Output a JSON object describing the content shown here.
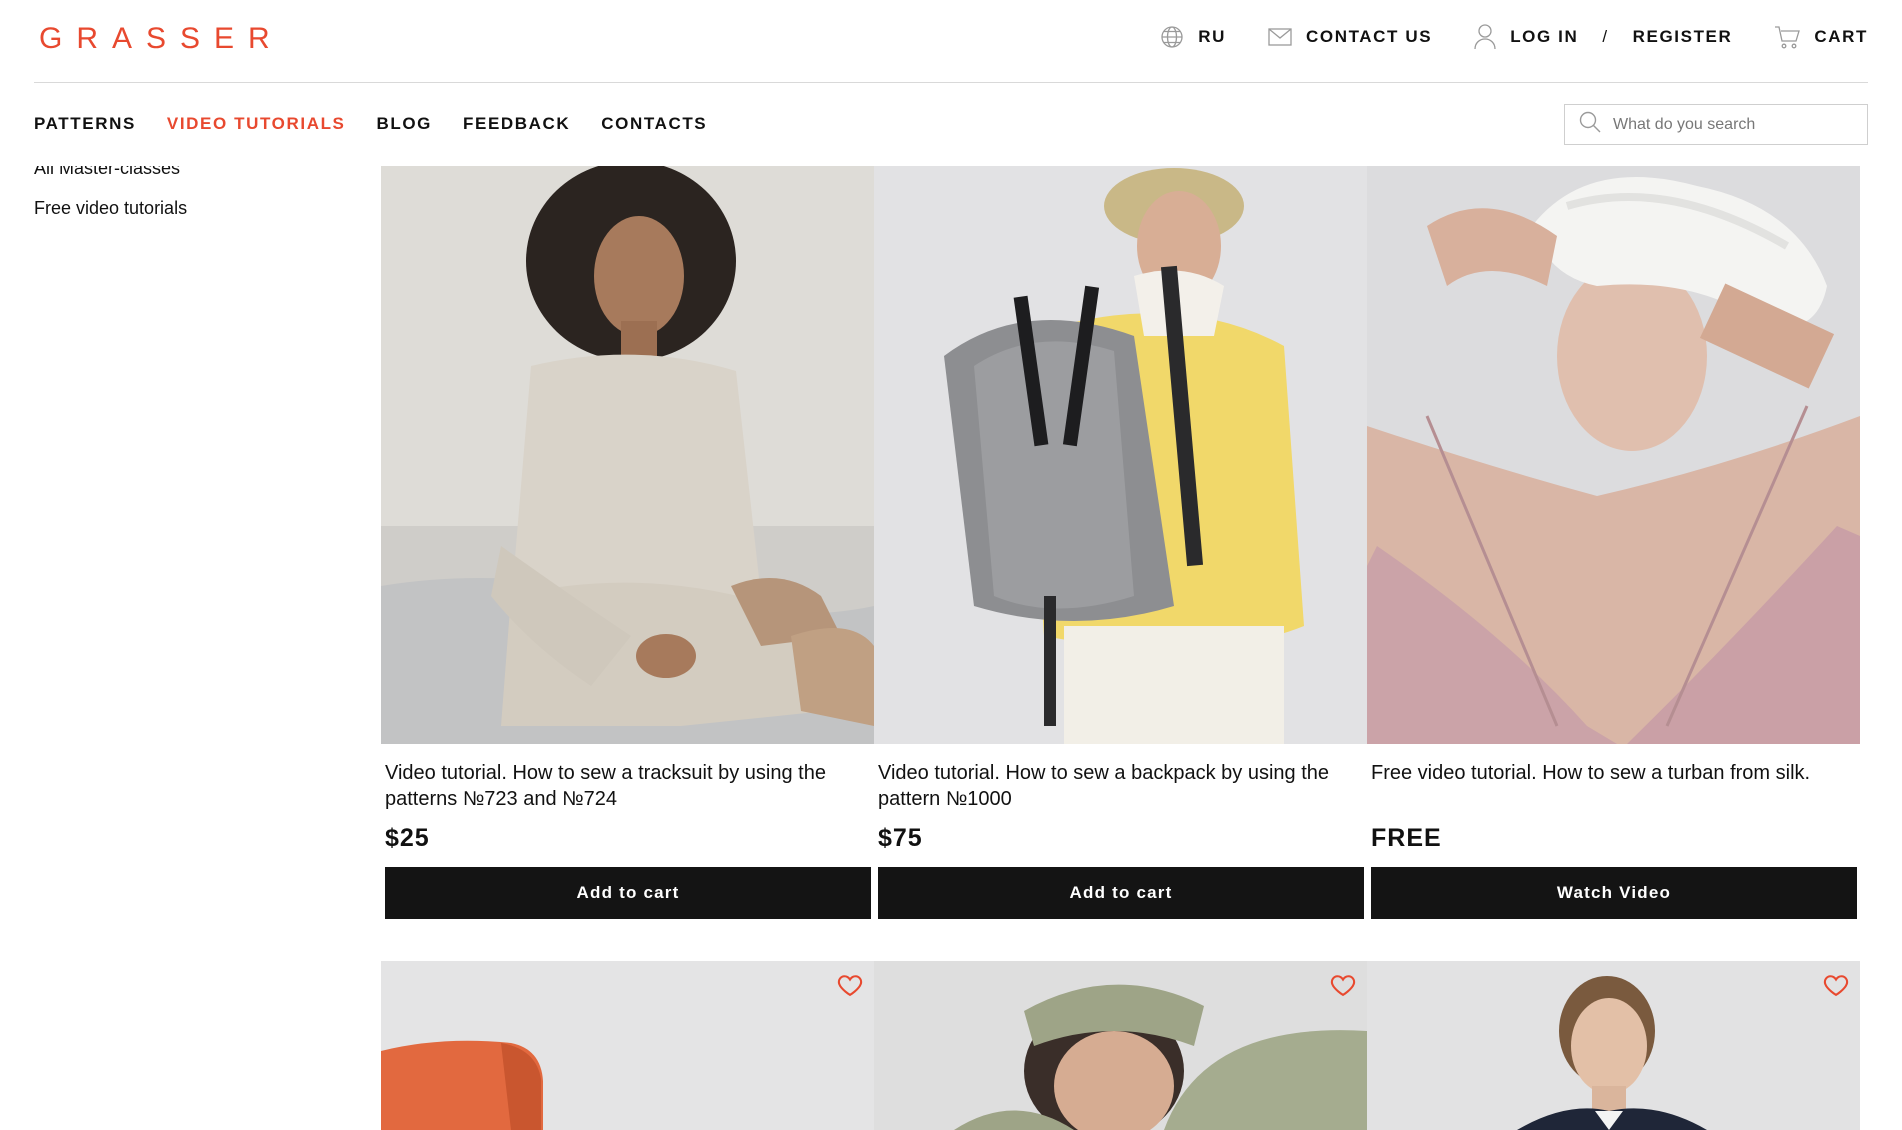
{
  "brand": {
    "logo": "GRASSER",
    "accent": "#e8492f"
  },
  "top_links": {
    "language": "RU",
    "contact": "CONTACT US",
    "login": "LOG IN",
    "separator": "/",
    "register": "REGISTER",
    "cart": "CART"
  },
  "nav": [
    {
      "label": "PATTERNS",
      "active": false
    },
    {
      "label": "VIDEO TUTORIALS",
      "active": true
    },
    {
      "label": "BLOG",
      "active": false
    },
    {
      "label": "FEEDBACK",
      "active": false
    },
    {
      "label": "CONTACTS",
      "active": false
    }
  ],
  "search": {
    "placeholder": "What do you search"
  },
  "sidebar": {
    "items": [
      {
        "label": "All Master-classes"
      },
      {
        "label": "Free video tutorials"
      }
    ]
  },
  "products": [
    {
      "title": "Video tutorial. How to sew a tracksuit by using the patterns №723 and №724",
      "price": "$25",
      "button": "Add to cart",
      "image": "woman-in-beige-tracksuit"
    },
    {
      "title": "Video tutorial. How to sew a backpack by using the pattern №1000",
      "price": "$75",
      "button": "Add to cart",
      "image": "man-with-grey-backpack"
    },
    {
      "title": "Free video tutorial. How to sew a turban from silk.",
      "price": "FREE",
      "button": "Watch Video",
      "image": "woman-in-white-silk-turban"
    }
  ],
  "products_row2": [
    {
      "image": "orange-cushion",
      "favorite_icon": "heart-icon"
    },
    {
      "image": "woman-with-sleep-mask",
      "favorite_icon": "heart-icon"
    },
    {
      "image": "woman-in-navy-blazer",
      "favorite_icon": "heart-icon"
    }
  ]
}
